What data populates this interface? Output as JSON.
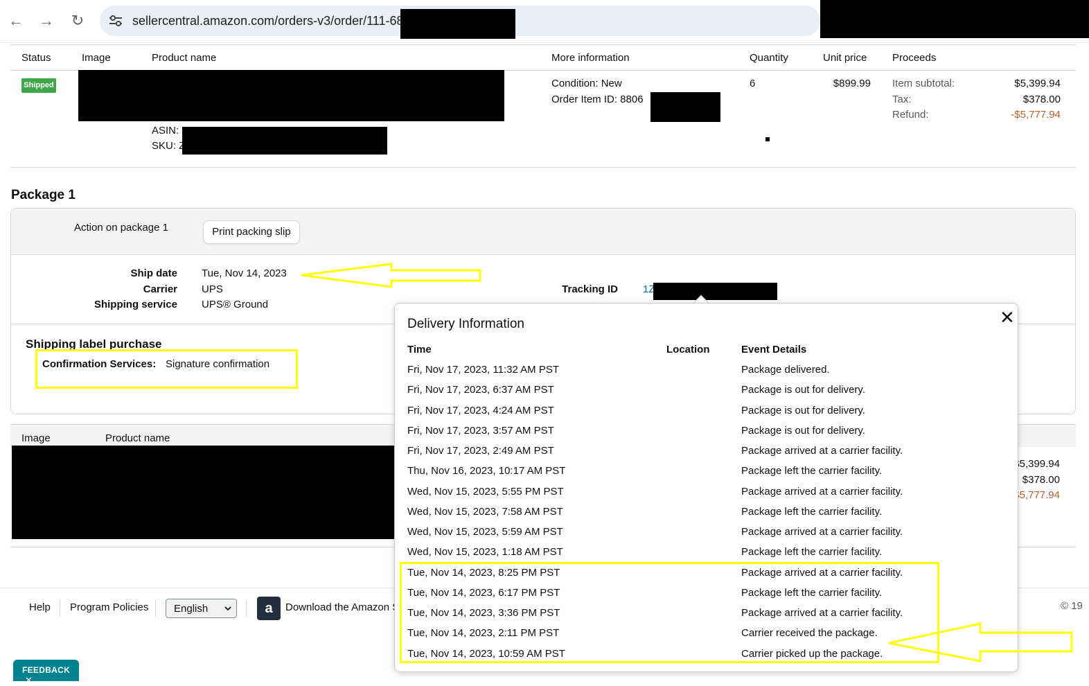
{
  "browser": {
    "url": "sellercentral.amazon.com/orders-v3/order/111-68"
  },
  "order_table": {
    "headers": {
      "status": "Status",
      "image": "Image",
      "product_name": "Product name",
      "more_info": "More information",
      "quantity": "Quantity",
      "unit_price": "Unit price",
      "proceeds": "Proceeds"
    },
    "row": {
      "status": "Shipped",
      "asin_label": "ASIN:",
      "sku_label": "SKU: Z",
      "condition": "Condition: New",
      "order_item_id": "Order Item ID: 8806",
      "quantity": "6",
      "unit_price": "$899.99",
      "item_subtotal_label": "Item subtotal:",
      "item_subtotal": "$5,399.94",
      "tax_label": "Tax:",
      "tax": "$378.00",
      "refund_label": "Refund:",
      "refund": "-$5,777.94"
    }
  },
  "package": {
    "title": "Package 1",
    "action_label": "Action on package 1",
    "print_button": "Print packing slip",
    "ship_date_label": "Ship date",
    "ship_date": "Tue, Nov 14, 2023",
    "carrier_label": "Carrier",
    "carrier": "UPS",
    "shipping_service_label": "Shipping service",
    "shipping_service": "UPS® Ground",
    "tracking_label": "Tracking ID",
    "tracking_prefix": "1Z",
    "label_purchase_title": "Shipping label purchase",
    "confirmation_label": "Confirmation Services:",
    "confirmation_value": "Signature confirmation"
  },
  "second_table": {
    "image": "Image",
    "product_name": "Product name",
    "subtotal": "$5,399.94",
    "tax": "$378.00",
    "refund": "$5,777.94"
  },
  "footer": {
    "help": "Help",
    "program_policies": "Program Policies",
    "language": "English",
    "download_app": "Download the Amazon S",
    "copyright": "© 19",
    "feedback": "FEEDBACK",
    "app_icon_letter": "a"
  },
  "delivery": {
    "title": "Delivery Information",
    "close": "✕",
    "headers": {
      "time": "Time",
      "location": "Location",
      "event": "Event Details"
    },
    "events": [
      {
        "time": "Fri, Nov 17, 2023, 11:32 AM PST",
        "detail": "Package delivered."
      },
      {
        "time": "Fri, Nov 17, 2023, 6:37 AM PST",
        "detail": "Package is out for delivery."
      },
      {
        "time": "Fri, Nov 17, 2023, 4:24 AM PST",
        "detail": "Package is out for delivery."
      },
      {
        "time": "Fri, Nov 17, 2023, 3:57 AM PST",
        "detail": "Package is out for delivery."
      },
      {
        "time": "Fri, Nov 17, 2023, 2:49 AM PST",
        "detail": "Package arrived at a carrier facility."
      },
      {
        "time": "Thu, Nov 16, 2023, 10:17 AM PST",
        "detail": "Package left the carrier facility."
      },
      {
        "time": "Wed, Nov 15, 2023, 5:55 PM PST",
        "detail": "Package arrived at a carrier facility."
      },
      {
        "time": "Wed, Nov 15, 2023, 7:58 AM PST",
        "detail": "Package left the carrier facility."
      },
      {
        "time": "Wed, Nov 15, 2023, 5:59 AM PST",
        "detail": "Package arrived at a carrier facility."
      },
      {
        "time": "Wed, Nov 15, 2023, 1:18 AM PST",
        "detail": "Package left the carrier facility."
      },
      {
        "time": "Tue, Nov 14, 2023, 8:25 PM PST",
        "detail": "Package arrived at a carrier facility."
      },
      {
        "time": "Tue, Nov 14, 2023, 6:17 PM PST",
        "detail": "Package left the carrier facility."
      },
      {
        "time": "Tue, Nov 14, 2023, 3:36 PM PST",
        "detail": "Package arrived at a carrier facility."
      },
      {
        "time": "Tue, Nov 14, 2023, 2:11 PM PST",
        "detail": "Carrier received the package."
      },
      {
        "time": "Tue, Nov 14, 2023, 10:59 AM PST",
        "detail": "Carrier picked up the package."
      }
    ]
  },
  "colors": {
    "annotation": "#ffff00",
    "shipped_badge": "#3fa64a",
    "refund": "#b75f2a",
    "feedback": "#00838f"
  },
  "icons": [
    "back-arrow-icon",
    "forward-arrow-icon",
    "reload-icon",
    "site-info-icon",
    "chevron-down-icon",
    "close-icon",
    "amazon-app-icon"
  ]
}
